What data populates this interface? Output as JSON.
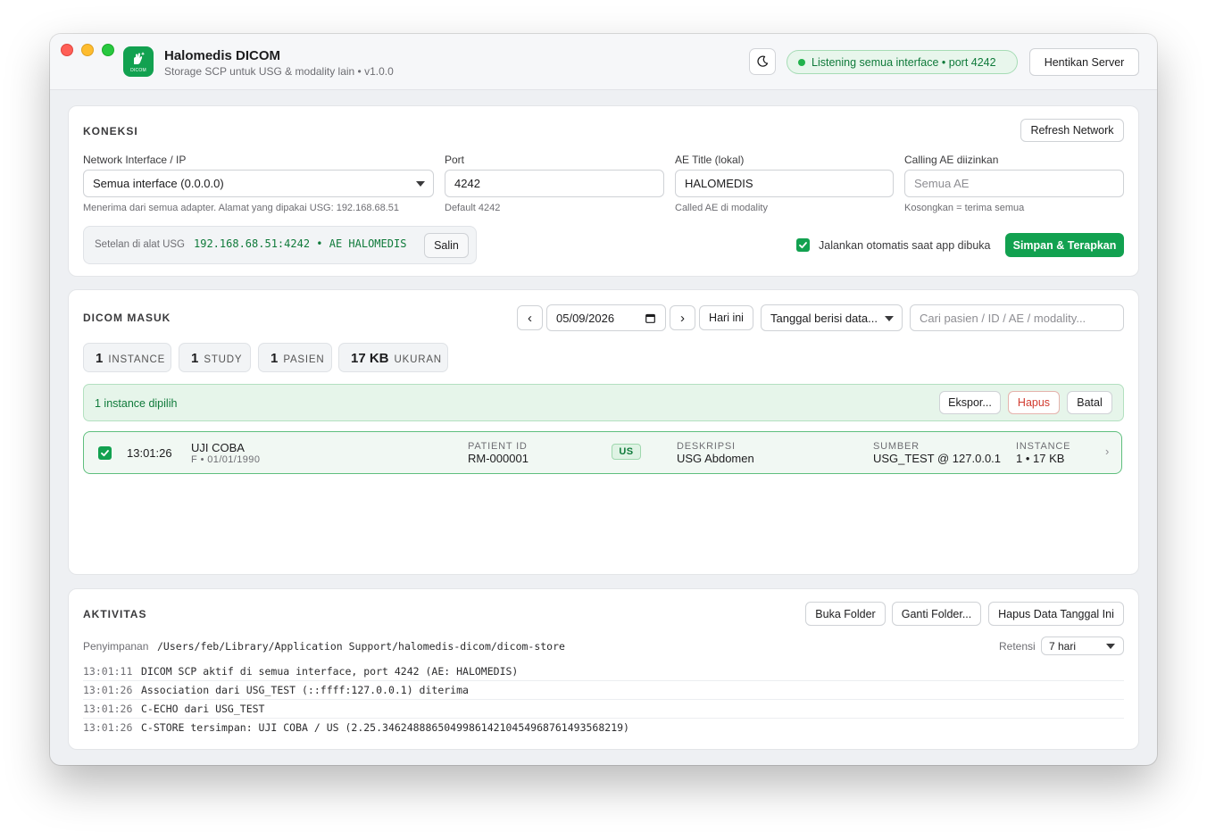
{
  "titlebar": {
    "app_title": "Halomedis DICOM",
    "app_subtitle": "Storage SCP untuk USG & modality lain • v1.0.0",
    "logo_text": "DICOM",
    "status": "Listening semua interface • port 4242",
    "stop_button": "Hentikan Server"
  },
  "koneksi": {
    "title": "KONEKSI",
    "refresh_button": "Refresh Network",
    "interface_label": "Network Interface / IP",
    "interface_value": "Semua interface (0.0.0.0)",
    "interface_hint": "Menerima dari semua adapter. Alamat yang dipakai USG: 192.168.68.51",
    "port_label": "Port",
    "port_value": "4242",
    "port_hint": "Default 4242",
    "ae_label": "AE Title (lokal)",
    "ae_value": "HALOMEDIS",
    "ae_hint": "Called AE di modality",
    "calling_label": "Calling AE diizinkan",
    "calling_placeholder": "Semua AE",
    "calling_hint": "Kosongkan = terima semua",
    "setelan_label": "Setelan di alat USG",
    "setelan_value": "192.168.68.51:4242 • AE HALOMEDIS",
    "copy_button": "Salin",
    "autostart_label": "Jalankan otomatis saat app dibuka",
    "save_button": "Simpan & Terapkan"
  },
  "dicom": {
    "title": "DICOM MASUK",
    "prev": "‹",
    "next": "›",
    "date": "05/09/2026",
    "today_button": "Hari ini",
    "date_filter": "Tanggal berisi data...",
    "search_placeholder": "Cari pasien / ID / AE / modality...",
    "stats": [
      {
        "num": "1",
        "label": "INSTANCE"
      },
      {
        "num": "1",
        "label": "STUDY"
      },
      {
        "num": "1",
        "label": "PASIEN"
      },
      {
        "num": "17 KB",
        "label": "UKURAN"
      }
    ],
    "selection_text": "1 instance dipilih",
    "export_button": "Ekspor...",
    "delete_button": "Hapus",
    "cancel_button": "Batal",
    "row": {
      "time": "13:01:26",
      "patient_name": "UJI COBA",
      "patient_meta": "F • 01/01/1990",
      "pid_caption": "PATIENT ID",
      "pid": "RM-000001",
      "modality": "US",
      "desc_caption": "DESKRIPSI",
      "desc": "USG Abdomen",
      "source_caption": "SUMBER",
      "source": "USG_TEST @ 127.0.0.1",
      "instance_caption": "INSTANCE",
      "instance": "1 • 17 KB",
      "chevron": "›"
    }
  },
  "aktivitas": {
    "title": "AKTIVITAS",
    "open_folder": "Buka Folder",
    "change_folder": "Ganti Folder...",
    "delete_date": "Hapus Data Tanggal Ini",
    "storage_label": "Penyimpanan",
    "storage_path": "/Users/feb/Library/Application Support/halomedis-dicom/dicom-store",
    "retention_label": "Retensi",
    "retention_value": "7 hari",
    "log": [
      {
        "time": "13:01:11",
        "msg": "DICOM SCP aktif di semua interface, port 4242 (AE: HALOMEDIS)"
      },
      {
        "time": "13:01:26",
        "msg": "Association dari USG_TEST (::ffff:127.0.0.1) diterima"
      },
      {
        "time": "13:01:26",
        "msg": "C-ECHO dari USG_TEST"
      },
      {
        "time": "13:01:26",
        "msg": "C-STORE tersimpan: UJI COBA / US (2.25.346248886504998614210454968761493568219)"
      }
    ]
  },
  "colors": {
    "accent": "#12a150",
    "status_text": "#0f7a3a",
    "danger": "#d23b2f"
  }
}
